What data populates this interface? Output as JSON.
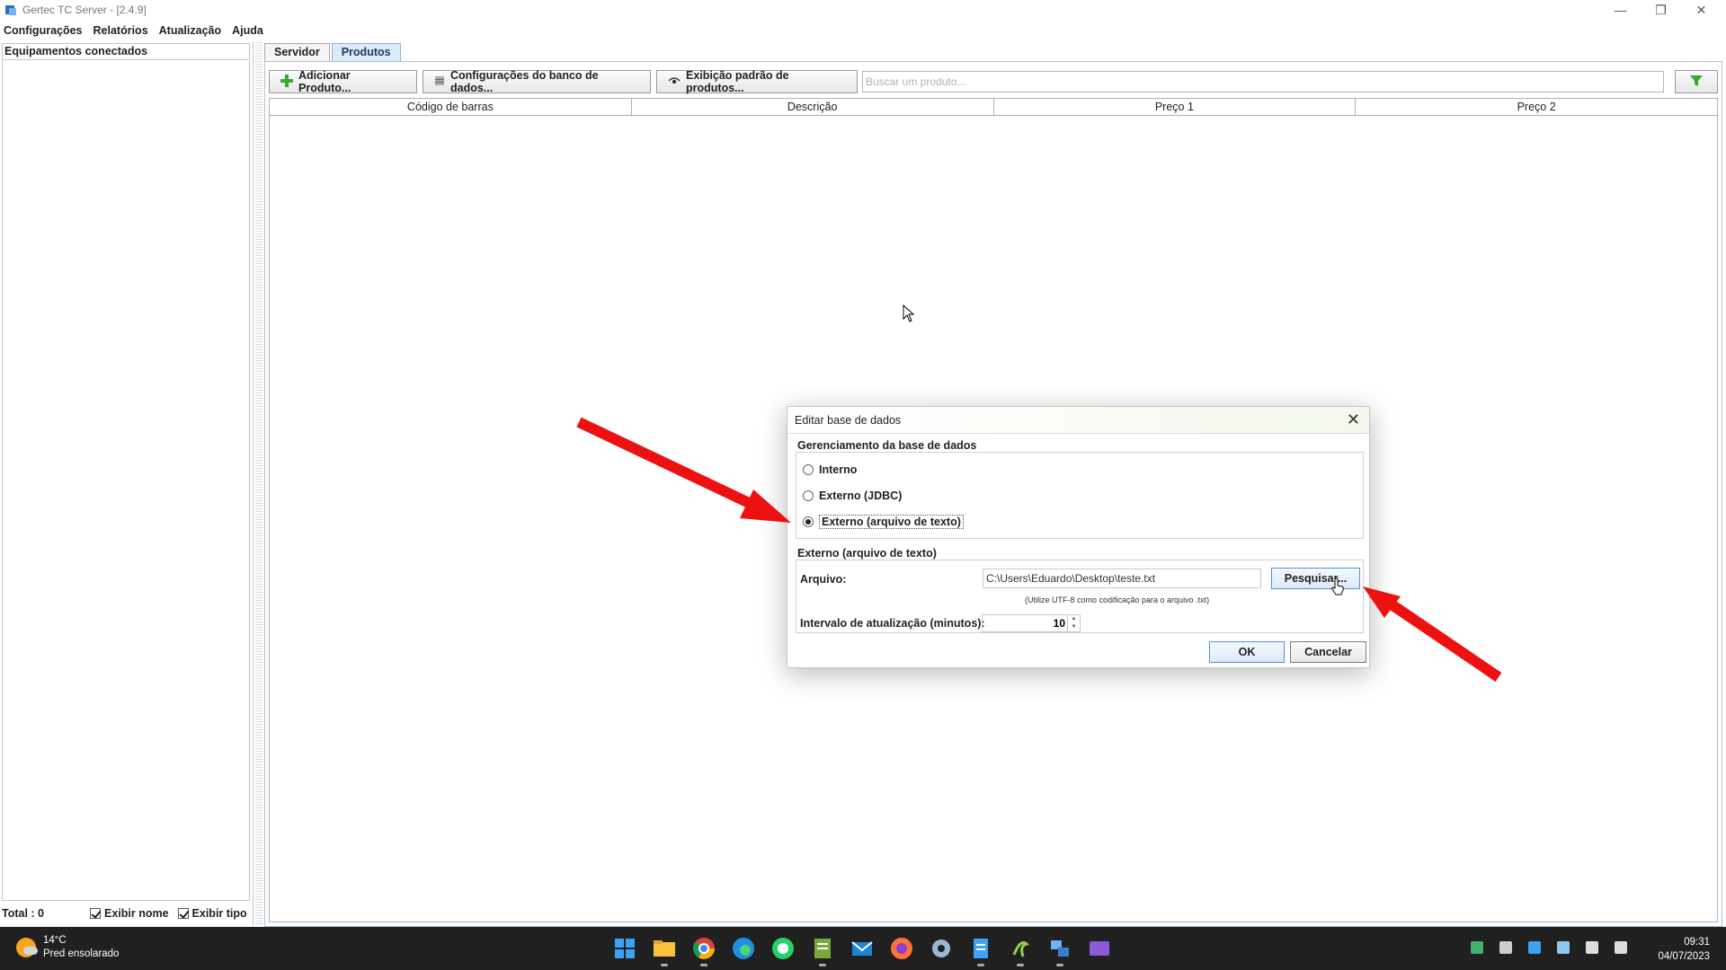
{
  "window": {
    "title": "Gertec TC Server - [2.4.9]",
    "controls": [
      "minimize-icon",
      "restore-icon",
      "close-icon"
    ]
  },
  "menu": [
    "Configurações",
    "Relatórios",
    "Atualização",
    "Ajuda"
  ],
  "left_panel": {
    "header": "Equipamentos conectados",
    "total": "Total : 0",
    "show_name": "Exibir nome",
    "show_type": "Exibir tipo"
  },
  "tabs": [
    {
      "label": "Servidor",
      "active": false
    },
    {
      "label": "Produtos",
      "active": true
    }
  ],
  "toolbar": {
    "add_product": "Adicionar Produto...",
    "db_config": "Configurações do banco de dados...",
    "default_view": "Exibição padrão de produtos...",
    "search_placeholder": "Buscar um produto...",
    "filter_icon": "funnel-icon"
  },
  "table": {
    "columns": [
      "Código de barras",
      "Descrição",
      "Preço 1",
      "Preço 2"
    ],
    "rows": []
  },
  "dialog": {
    "title": "Editar base de dados",
    "group1_label": "Gerenciamento da base de dados",
    "options": [
      "Interno",
      "Externo (JDBC)",
      "Externo (arquivo de texto)"
    ],
    "selected_option": "Externo (arquivo de texto)",
    "group2_label": "Externo (arquivo de texto)",
    "file_label": "Arquivo:",
    "file_value": "C:\\Users\\Eduardo\\Desktop\\teste.txt",
    "browse": "Pesquisar...",
    "hint": "(Utilize UTF-8 como codificação para o arquivo .txt)",
    "interval_label": "Intervalo de atualização (minutos):",
    "interval_value": "10",
    "ok": "OK",
    "cancel": "Cancelar"
  },
  "annotation_color": "#ee1111",
  "taskbar": {
    "temperature": "14°C",
    "weather": "Pred ensolarado",
    "time": "09:31",
    "date": "04/07/2023",
    "apps": [
      "windows-start-icon",
      "file-explorer-icon",
      "chrome-icon",
      "edge-icon",
      "whatsapp-icon",
      "spreadsheet-icon",
      "mail-icon",
      "firefox-icon",
      "settings-icon",
      "notepad-icon",
      "app-icon",
      "network-icon",
      "video-icon"
    ]
  }
}
